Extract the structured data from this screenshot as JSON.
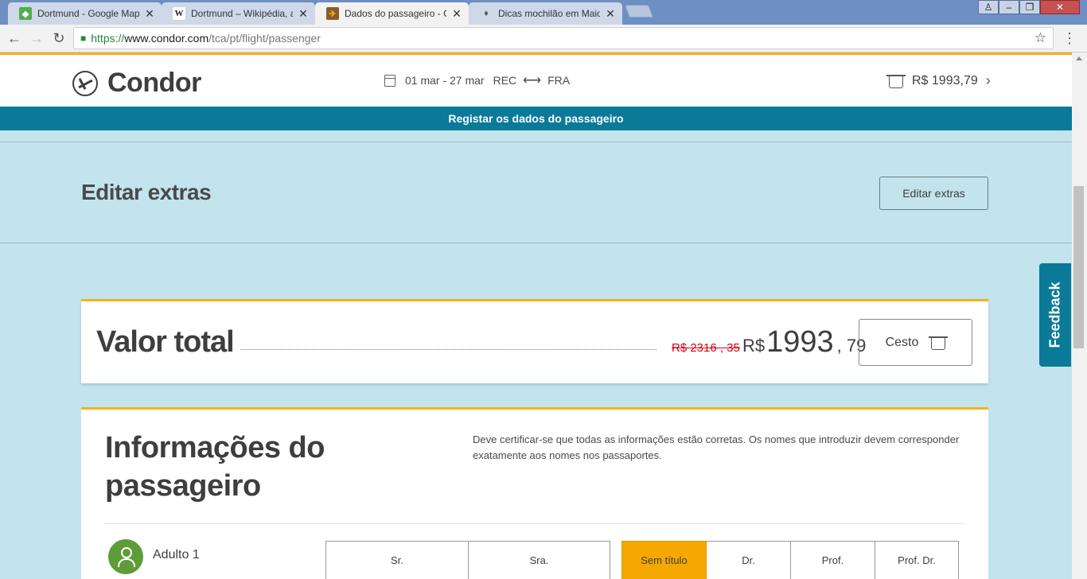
{
  "browser": {
    "tabs": [
      {
        "title": "Dortmund - Google Map",
        "icon": "google-maps-icon"
      },
      {
        "title": "Dortmund – Wikipédia, a",
        "icon": "wikipedia-icon"
      },
      {
        "title": "Dados do passageiro - Co",
        "icon": "condor-icon"
      },
      {
        "title": "Dicas mochilão em Maio",
        "icon": "pin-icon"
      }
    ],
    "url": {
      "scheme": "https://",
      "host": "www.condor.com",
      "path": "/tca/pt/flight/passenger"
    }
  },
  "header": {
    "brand": "Condor",
    "dates": "01 mar - 27 mar",
    "origin": "REC",
    "destination": "FRA",
    "basket_total": "R$ 1993,79"
  },
  "band": {
    "text": "Registar os dados do passageiro"
  },
  "extras": {
    "heading": "Editar extras",
    "button": "Editar extras"
  },
  "total": {
    "label": "Valor total",
    "old_price": "R$ 2316 , 35",
    "currency": "R$",
    "price_int": "1993",
    "price_dec": ", 79",
    "cart_button": "Cesto"
  },
  "passenger": {
    "heading": "Informações do passageiro",
    "note": "Deve certificar-se que todas as informações estão corretas. Os nomes que introduzir devem corresponder exatamente aos nomes nos passaportes.",
    "adult_label": "Adulto 1",
    "gender_options": [
      "Sr.",
      "Sra."
    ],
    "title_options": [
      "Sem título",
      "Dr.",
      "Prof.",
      "Prof. Dr."
    ],
    "title_selected": "Sem título"
  },
  "feedback": {
    "label": "Feedback"
  },
  "colors": {
    "accent": "#f2b31e",
    "brand_blue": "#0a7a98",
    "background": "#c3e4ec",
    "selected": "#f5a800",
    "strike_red": "#d0021b"
  }
}
